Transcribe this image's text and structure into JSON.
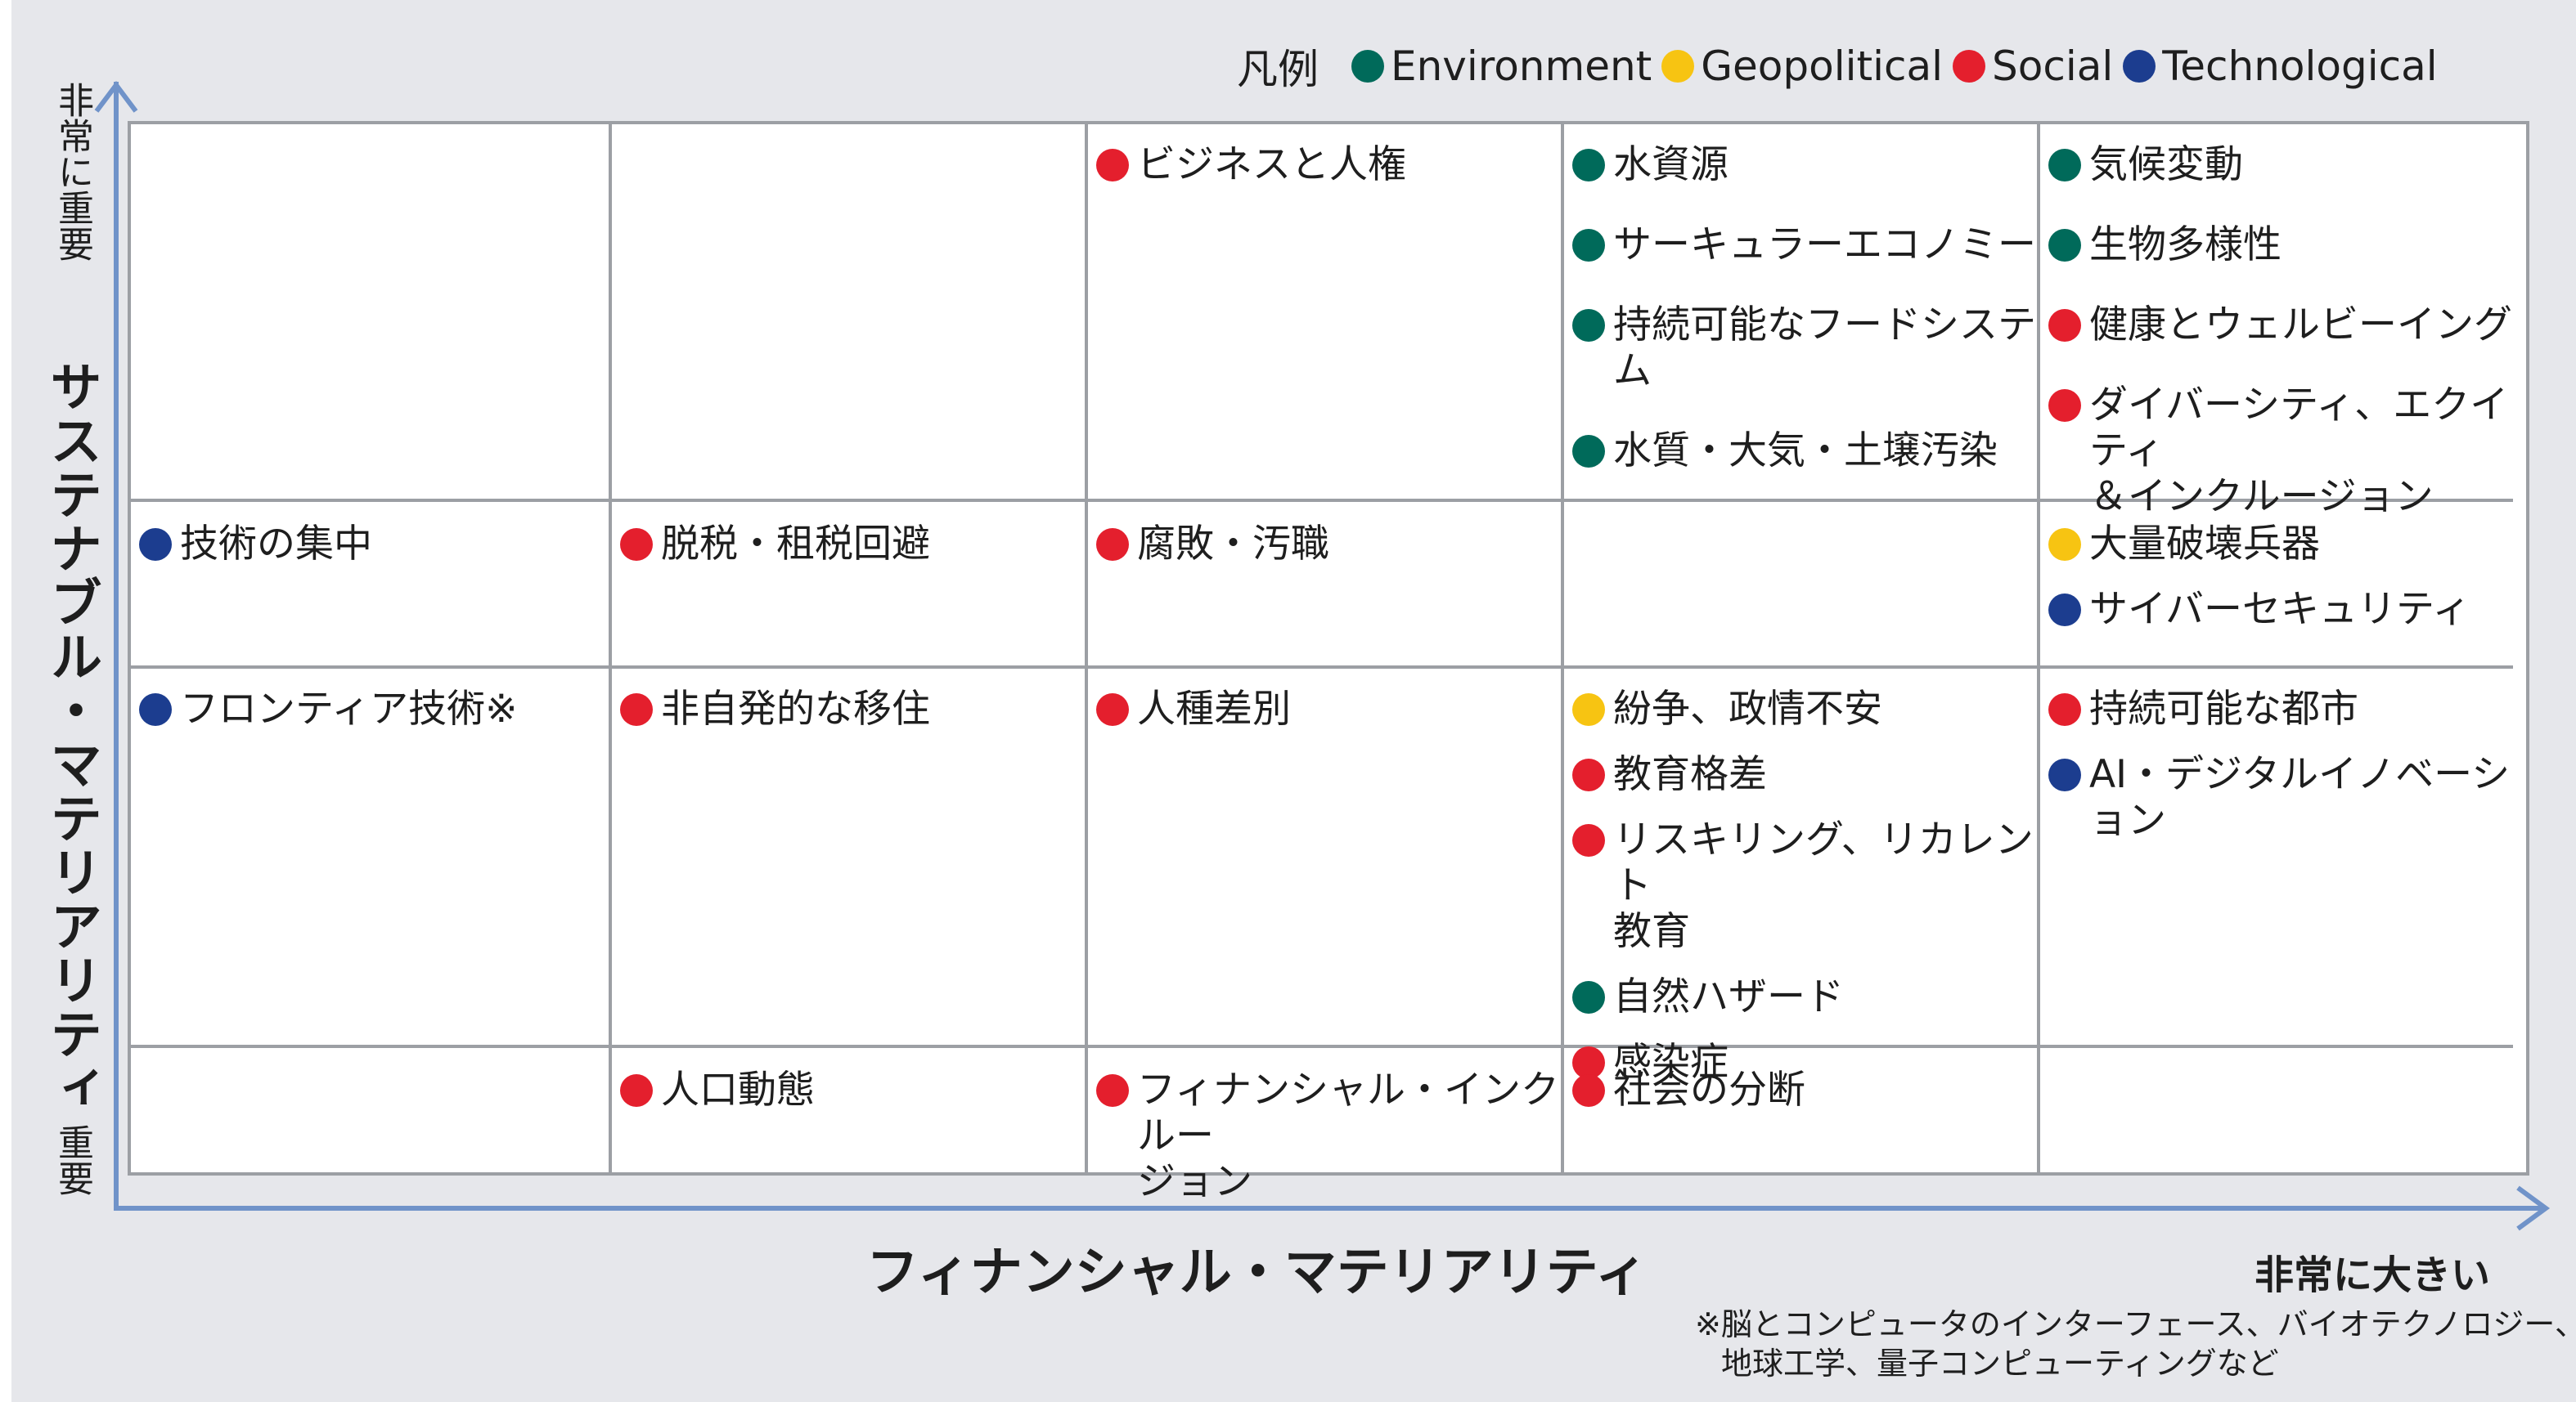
{
  "legend": {
    "title": "凡例",
    "items": [
      {
        "label": "Environment",
        "color": "#006a5a"
      },
      {
        "label": "Geopolitical",
        "color": "#f7c412"
      },
      {
        "label": "Social",
        "color": "#e41f2d"
      },
      {
        "label": "Technological",
        "color": "#1c3d8f"
      }
    ]
  },
  "axes": {
    "y_title": "サステナブル・マテリアリティ",
    "y_top": "非常に重要",
    "y_bottom": "重要",
    "x_title": "フィナンシャル・マテリアリティ",
    "x_right": "非常に大きい"
  },
  "footnote": {
    "line1": "※脳とコンピュータのインターフェース、バイオテクノロジー、",
    "line2": "地球工学、量子コンピューティングなど"
  },
  "colors": {
    "Environment": "#006a5a",
    "Geopolitical": "#f7c412",
    "Social": "#e41f2d",
    "Technological": "#1c3d8f"
  },
  "grid": {
    "rows": [
      [
        [],
        [],
        [
          {
            "label": "ビジネスと人権",
            "category": "Social"
          }
        ],
        [
          {
            "label": "水資源",
            "category": "Environment"
          },
          {
            "label": "サーキュラーエコノミー",
            "category": "Environment"
          },
          {
            "label": "持続可能なフードシステム",
            "category": "Environment"
          },
          {
            "label": "水質・大気・土壌汚染",
            "category": "Environment"
          }
        ],
        [
          {
            "label": "気候変動",
            "category": "Environment"
          },
          {
            "label": "生物多様性",
            "category": "Environment"
          },
          {
            "label": "健康とウェルビーイング",
            "category": "Social"
          },
          {
            "label": "ダイバーシティ、エクイティ\n＆インクルージョン",
            "category": "Social"
          }
        ]
      ],
      [
        [
          {
            "label": "技術の集中",
            "category": "Technological"
          }
        ],
        [
          {
            "label": "脱税・租税回避",
            "category": "Social"
          }
        ],
        [
          {
            "label": "腐敗・汚職",
            "category": "Social"
          }
        ],
        [],
        [
          {
            "label": "大量破壊兵器",
            "category": "Geopolitical"
          },
          {
            "label": "サイバーセキュリティ",
            "category": "Technological"
          }
        ]
      ],
      [
        [
          {
            "label": "フロンティア技術※",
            "category": "Technological"
          }
        ],
        [
          {
            "label": "非自発的な移住",
            "category": "Social"
          }
        ],
        [
          {
            "label": "人種差別",
            "category": "Social"
          }
        ],
        [
          {
            "label": "紛争、政情不安",
            "category": "Geopolitical"
          },
          {
            "label": "教育格差",
            "category": "Social"
          },
          {
            "label": "リスキリング、リカレント\n教育",
            "category": "Social"
          },
          {
            "label": "自然ハザード",
            "category": "Environment"
          },
          {
            "label": "感染症",
            "category": "Social"
          }
        ],
        [
          {
            "label": "持続可能な都市",
            "category": "Social"
          },
          {
            "label": "AI・デジタルイノベーション",
            "category": "Technological"
          }
        ]
      ],
      [
        [],
        [
          {
            "label": "人口動態",
            "category": "Social"
          }
        ],
        [
          {
            "label": "フィナンシャル・インクルー\nジョン",
            "category": "Social"
          }
        ],
        [
          {
            "label": "社会の分断",
            "category": "Social"
          }
        ],
        []
      ]
    ]
  }
}
